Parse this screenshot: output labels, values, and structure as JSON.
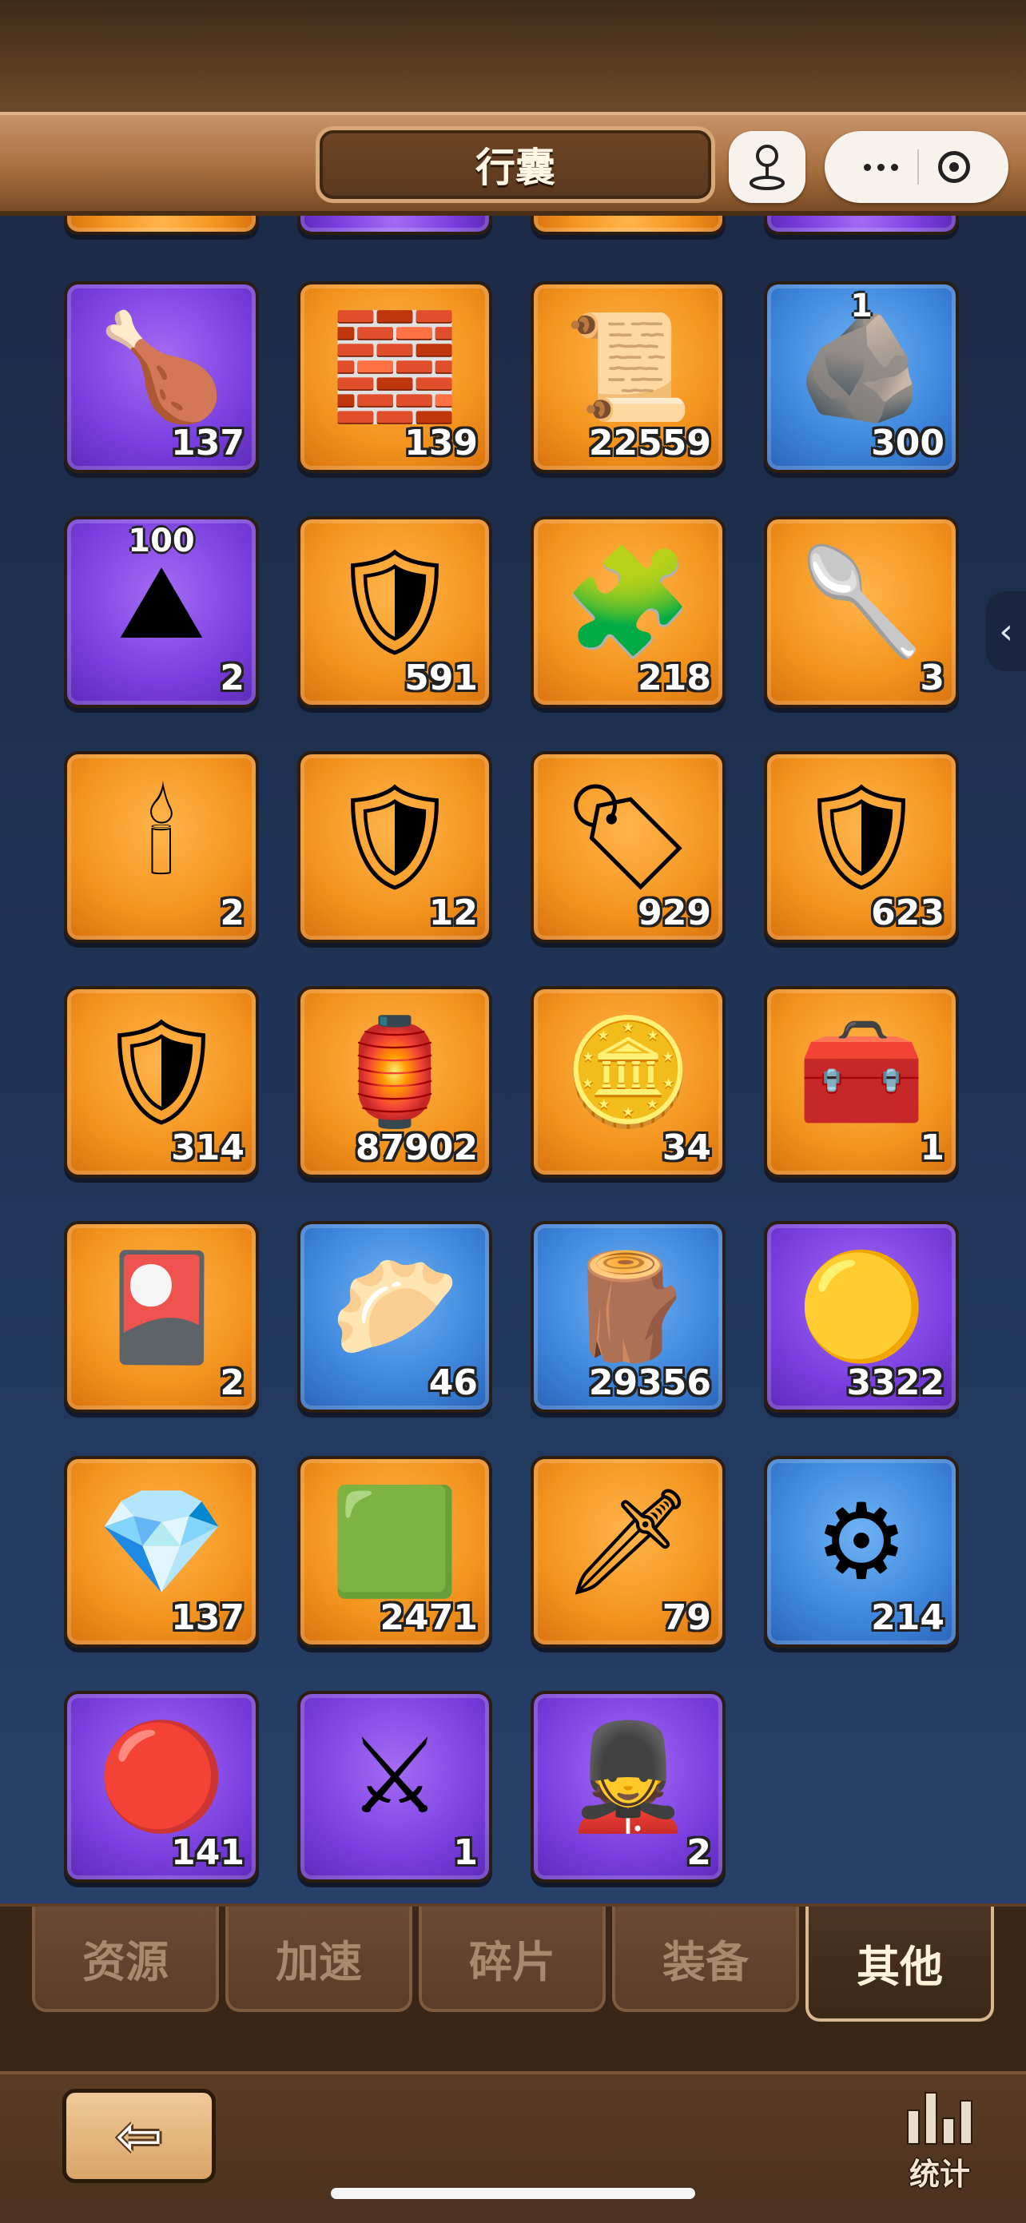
{
  "header": {
    "title": "行囊"
  },
  "miniprogram": {
    "icons": [
      "joystick-icon",
      "more-icon",
      "close-target-icon"
    ]
  },
  "items": [
    {
      "color": "purple",
      "icon": "drumstick-icon",
      "glyph": "🍗",
      "count": "137",
      "badge": ""
    },
    {
      "color": "orange",
      "icon": "jade-brick-icon",
      "glyph": "🧱",
      "count": "139",
      "badge": ""
    },
    {
      "color": "orange",
      "icon": "scroll-icon",
      "glyph": "📜",
      "count": "22559",
      "badge": ""
    },
    {
      "color": "blue",
      "icon": "ore-chunk-icon",
      "glyph": "🪨",
      "count": "300",
      "badge": "1"
    },
    {
      "color": "purple",
      "icon": "iron-ore-icon",
      "glyph": "⛰",
      "count": "2",
      "badge": "100"
    },
    {
      "color": "orange",
      "icon": "hammer-badge-icon",
      "glyph": "🛡",
      "count": "591",
      "badge": ""
    },
    {
      "color": "orange",
      "icon": "sword-puzzle-icon",
      "glyph": "🧩",
      "count": "218",
      "badge": ""
    },
    {
      "color": "orange",
      "icon": "golden-spoon-icon",
      "glyph": "🥄",
      "count": "3",
      "badge": ""
    },
    {
      "color": "orange",
      "icon": "candle-icon",
      "glyph": "🕯",
      "count": "2",
      "badge": ""
    },
    {
      "color": "orange",
      "icon": "blue-crest-icon",
      "glyph": "🛡",
      "count": "12",
      "badge": ""
    },
    {
      "color": "orange",
      "icon": "east-token-icon",
      "glyph": "🏷",
      "count": "929",
      "badge": ""
    },
    {
      "color": "orange",
      "icon": "red-crest-icon",
      "glyph": "🛡",
      "count": "623",
      "badge": ""
    },
    {
      "color": "orange",
      "icon": "swirl-crest-icon",
      "glyph": "🛡",
      "count": "314",
      "badge": ""
    },
    {
      "color": "orange",
      "icon": "lantern-icon",
      "glyph": "🏮",
      "count": "87902",
      "badge": ""
    },
    {
      "color": "orange",
      "icon": "palace-coin-icon",
      "glyph": "🪙",
      "count": "34",
      "badge": ""
    },
    {
      "color": "orange",
      "icon": "treasure-chest-icon",
      "glyph": "🧰",
      "count": "1",
      "badge": ""
    },
    {
      "color": "orange",
      "icon": "chariot-card-icon",
      "glyph": "🎴",
      "count": "2",
      "badge": ""
    },
    {
      "color": "blue",
      "icon": "dumplings-icon",
      "glyph": "🥟",
      "count": "46",
      "badge": ""
    },
    {
      "color": "blue",
      "icon": "log-icon",
      "glyph": "🪵",
      "count": "29356",
      "badge": ""
    },
    {
      "color": "purple",
      "icon": "gold-nugget-icon",
      "glyph": "🟡",
      "count": "3322",
      "badge": ""
    },
    {
      "color": "orange",
      "icon": "sapphire-icon",
      "glyph": "💎",
      "count": "137",
      "badge": ""
    },
    {
      "color": "orange",
      "icon": "jade-stone-icon",
      "glyph": "🟩",
      "count": "2471",
      "badge": ""
    },
    {
      "color": "orange",
      "icon": "dagger-icon",
      "glyph": "🗡",
      "count": "79",
      "badge": ""
    },
    {
      "color": "blue",
      "icon": "silver-seal-icon",
      "glyph": "⚙",
      "count": "214",
      "badge": ""
    },
    {
      "color": "purple",
      "icon": "red-seal-icon",
      "glyph": "🔴",
      "count": "141",
      "badge": ""
    },
    {
      "color": "purple",
      "icon": "troops-advance-icon",
      "glyph": "⚔",
      "count": "1",
      "badge": ""
    },
    {
      "color": "purple",
      "icon": "soldier-return-icon",
      "glyph": "💂",
      "count": "2",
      "badge": ""
    }
  ],
  "partial_row_colors": [
    "orange",
    "purple",
    "orange",
    "purple"
  ],
  "tabs": [
    {
      "label": "资源",
      "active": false
    },
    {
      "label": "加速",
      "active": false
    },
    {
      "label": "碎片",
      "active": false
    },
    {
      "label": "装备",
      "active": false
    },
    {
      "label": "其他",
      "active": true
    }
  ],
  "footer": {
    "stats_label": "统计"
  }
}
